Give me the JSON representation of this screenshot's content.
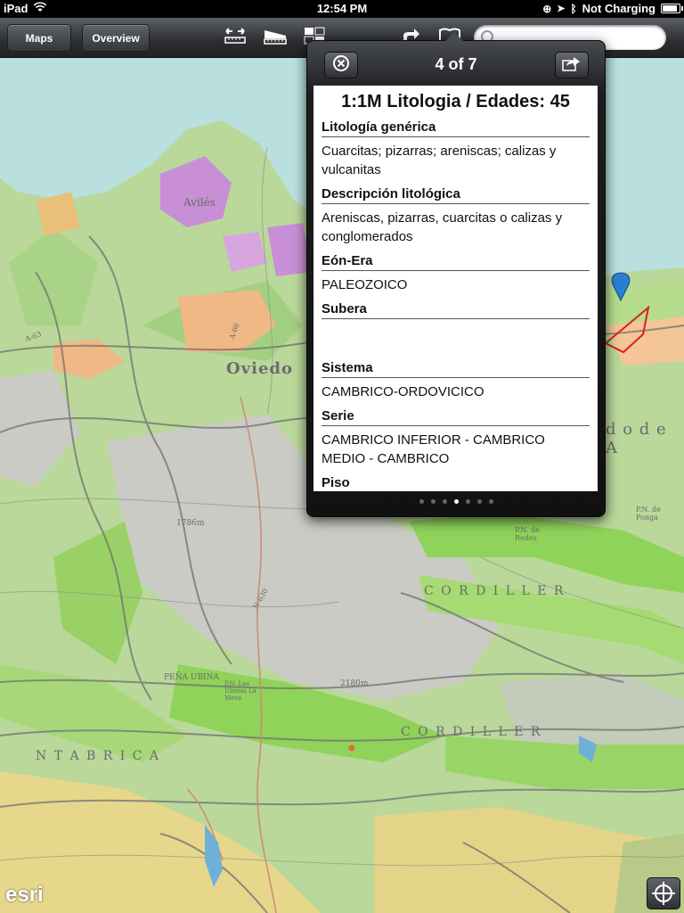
{
  "status_bar": {
    "device": "iPad",
    "time": "12:54 PM",
    "charging": "Not Charging"
  },
  "toolbar": {
    "maps_label": "Maps",
    "overview_label": "Overview",
    "icons": [
      "measure-icon",
      "legend-icon",
      "basemap-icon",
      "share-icon",
      "bookmarks-icon"
    ],
    "search": {
      "value": "",
      "placeholder": ""
    }
  },
  "popup": {
    "counter": "4 of 7",
    "title": "1:1M Litologia / Edades:  45",
    "fields": [
      {
        "label": "Litología genérica",
        "value": "Cuarcitas; pizarras; areniscas; calizas y vulcanitas"
      },
      {
        "label": "Descripción litológica",
        "value": "Areniscas, pizarras, cuarcitas o calizas y conglomerados"
      },
      {
        "label": "Eón-Era",
        "value": "PALEOZOICO"
      },
      {
        "label": "Subera",
        "value": ""
      },
      {
        "label": "Sistema",
        "value": "CAMBRICO-ORDOVICICO"
      },
      {
        "label": "Serie",
        "value": "CAMBRICO INFERIOR - CAMBRICO MEDIO - CAMBRICO"
      },
      {
        "label": "Piso",
        "value": ""
      }
    ],
    "page_count": 7,
    "current_page": 4
  },
  "map": {
    "labels": {
      "aviles": "Avilés",
      "oviedo": "Oviedo",
      "cordillera1": "C O R D I L L E R",
      "cordillera2": "C O R D I L L E R",
      "cantabrica": "N T A B R I C A",
      "pena_ubina": "PEÑA UBINA",
      "elev1": "2180m",
      "elev2": "1786m",
      "road1": "N-630",
      "road2": "A-66",
      "road3": "A-63",
      "partial_right": "d o  d e  A",
      "pn_ponga": "P.N. de Ponga",
      "pn_redes": "P.N. de Redes",
      "pn_lasubinas": "P.N. Las Ubiñas La Mesa"
    },
    "colors": {
      "sea": "#b9e0df",
      "land_green": "#b9d89a",
      "bright_green": "#8fd35a",
      "purple": "#c88fd6",
      "orange": "#f0b884",
      "yellow": "#e7d78a",
      "gray": "#c9cbc4"
    }
  },
  "branding": {
    "esri": "esri"
  },
  "controls": {
    "locate_icon": "locate-icon"
  }
}
